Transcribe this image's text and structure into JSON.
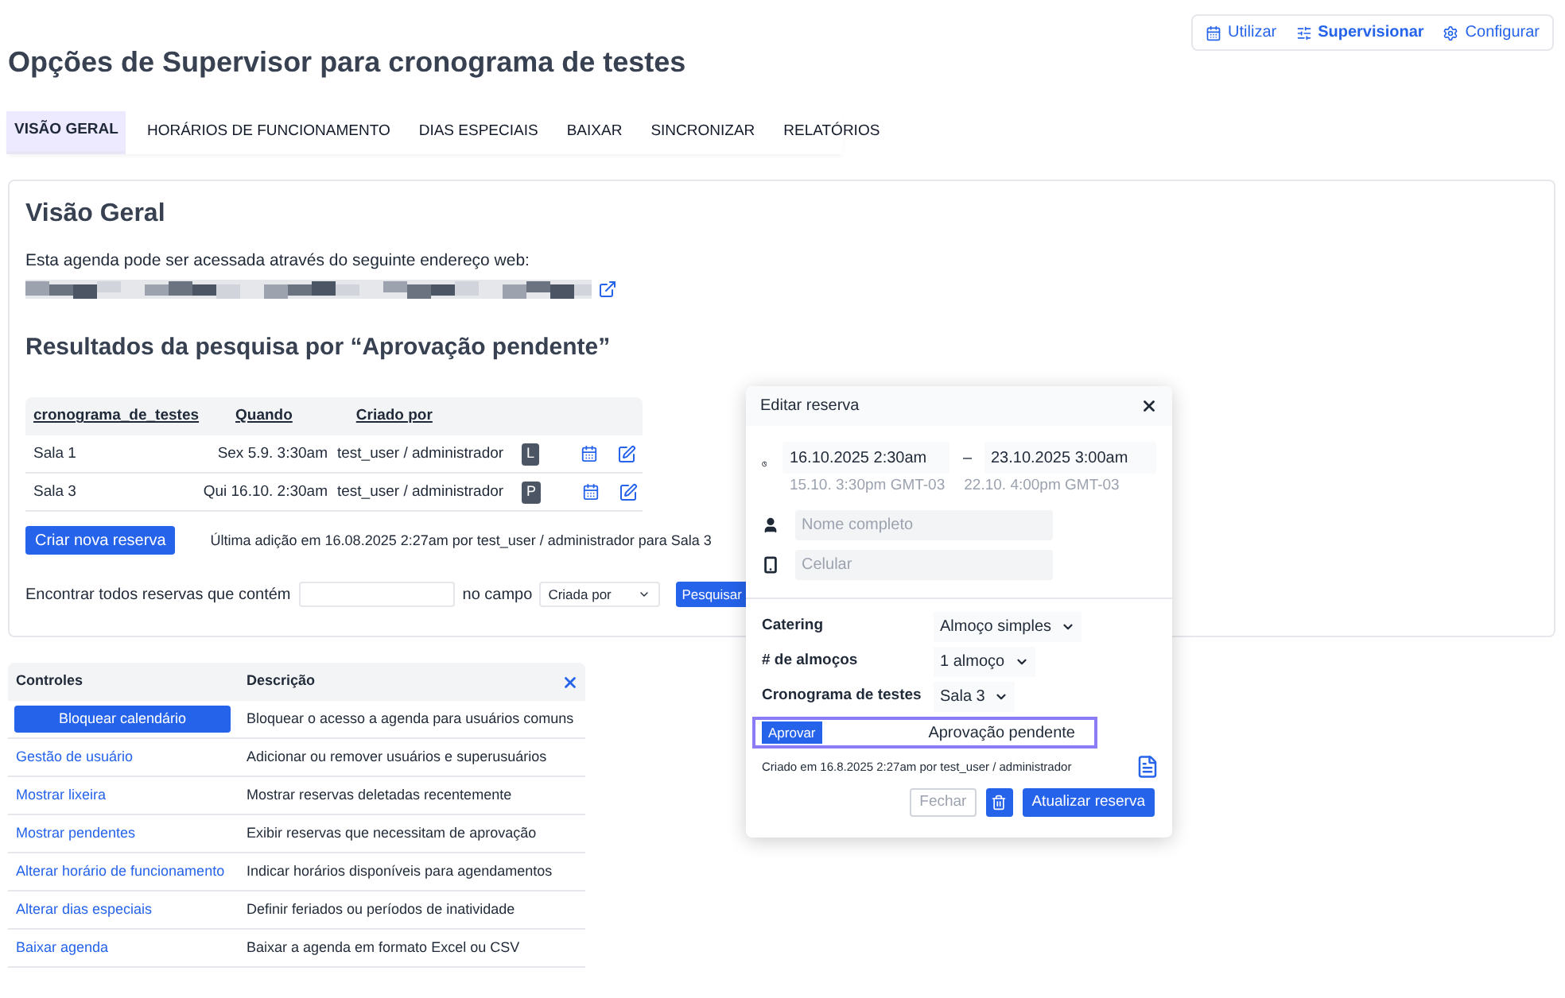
{
  "mode_switch": [
    {
      "label": "Utilizar",
      "selected": false
    },
    {
      "label": "Supervisionar",
      "selected": true
    },
    {
      "label": "Configurar",
      "selected": false
    }
  ],
  "title": "Opções de Supervisor para cronograma de testes",
  "tabs": [
    {
      "label": "VISÃO GERAL",
      "selected": true
    },
    {
      "label": "HORÁRIOS DE FUNCIONAMENTO",
      "selected": false
    },
    {
      "label": "DIAS ESPECIAIS",
      "selected": false
    },
    {
      "label": "BAIXAR",
      "selected": false
    },
    {
      "label": "SINCRONIZAR",
      "selected": false
    },
    {
      "label": "RELATÓRIOS",
      "selected": false
    }
  ],
  "overview": {
    "heading": "Visão Geral",
    "access_text": "Esta agenda pode ser acessada através do seguinte endereço web:",
    "results_heading": "Resultados da pesquisa por “Aprovação pendente”",
    "columns": [
      "cronograma_de_testes",
      "Quando",
      "Criado por"
    ],
    "rows": [
      {
        "schedule": "Sala 1",
        "when": "Sex 5.9. 3:30am",
        "created_by": "test_user / administrador",
        "badge": "L"
      },
      {
        "schedule": "Sala 3",
        "when": "Qui 16.10. 2:30am",
        "created_by": "test_user / administrador",
        "badge": "P"
      }
    ],
    "create_button": "Criar nova reserva",
    "last_added": "Última adição em 16.08.2025 2:27am por test_user / administrador para Sala 3",
    "search": {
      "label": "Encontrar todos reservas que contém",
      "field_label": "no campo",
      "field_value": "Criada por",
      "button": "Pesquisar"
    }
  },
  "controls": {
    "columns": [
      "Controles",
      "Descrição"
    ],
    "rows": [
      {
        "kind": "button",
        "control": "Bloquear calendário",
        "description": "Bloquear o acesso a agenda para usuários comuns"
      },
      {
        "kind": "link",
        "control": "Gestão de usuário",
        "description": "Adicionar ou remover usuários e superusuários"
      },
      {
        "kind": "link",
        "control": "Mostrar lixeira",
        "description": "Mostrar reservas deletadas recentemente"
      },
      {
        "kind": "link",
        "control": "Mostrar pendentes",
        "description": "Exibir reservas que necessitam de aprovação"
      },
      {
        "kind": "link",
        "control": "Alterar horário de funcionamento",
        "description": "Indicar horários disponíveis para agendamentos"
      },
      {
        "kind": "link",
        "control": "Alterar dias especiais",
        "description": "Definir feriados ou períodos de inatividade"
      },
      {
        "kind": "link",
        "control": "Baixar agenda",
        "description": "Baixar a agenda em formato Excel ou CSV"
      }
    ]
  },
  "modal": {
    "title": "Editar reserva",
    "start": "16.10.2025 2:30am",
    "separator": "–",
    "end": "23.10.2025 3:00am",
    "start_local": "15.10. 3:30pm GMT-03",
    "end_local": "22.10. 4:00pm GMT-03",
    "name_placeholder": "Nome completo",
    "phone_placeholder": "Celular",
    "fields": [
      {
        "label": "Catering",
        "value": "Almoço simples"
      },
      {
        "label": "# de almoços",
        "value": "1 almoço"
      },
      {
        "label": "Cronograma de testes",
        "value": "Sala 3"
      }
    ],
    "approve_button": "Aprovar",
    "status": "Aprovação pendente",
    "created": "Criado em 16.8.2025 2:27am por test_user / administrador",
    "close_button": "Fechar",
    "update_button": "Atualizar reserva"
  }
}
